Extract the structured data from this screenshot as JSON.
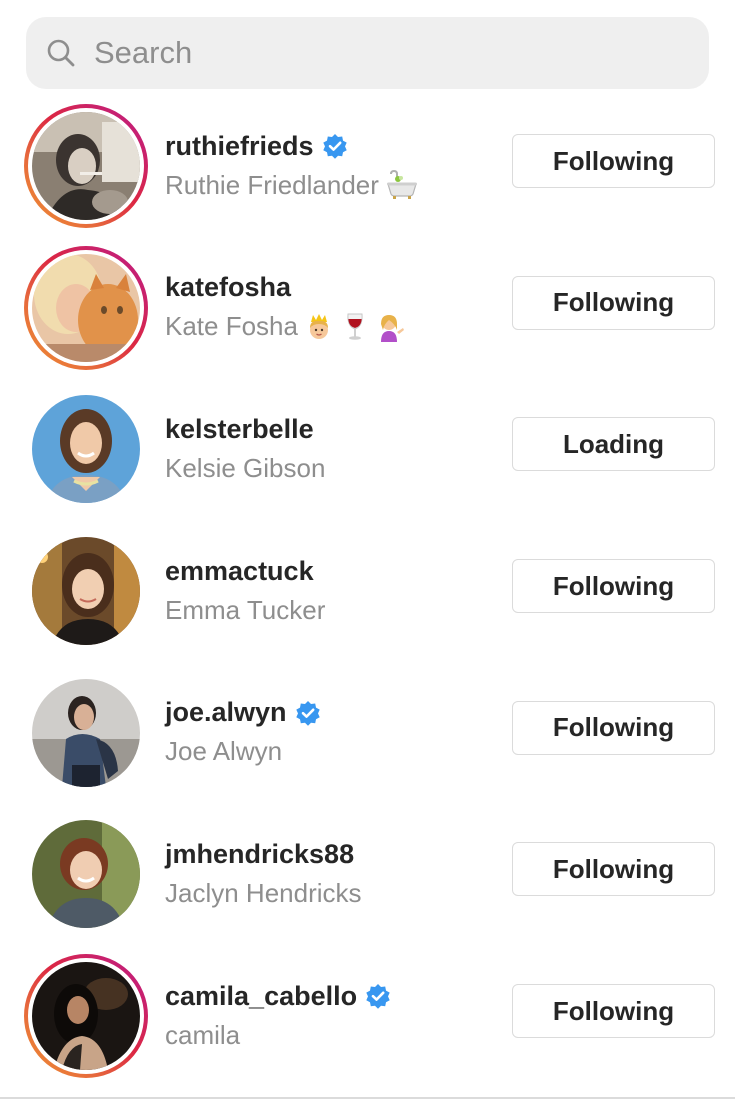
{
  "search": {
    "placeholder": "Search",
    "value": ""
  },
  "users": [
    {
      "username": "ruthiefrieds",
      "full_name": "Ruthie Friedlander",
      "verified": true,
      "has_story": true,
      "emojis": [
        "bathtub"
      ],
      "button": "Following"
    },
    {
      "username": "katefosha",
      "full_name": "Kate Fosha",
      "verified": false,
      "has_story": true,
      "emojis": [
        "princess",
        "wine-glass",
        "tipping-hand-woman"
      ],
      "button": "Following"
    },
    {
      "username": "kelsterbelle",
      "full_name": "Kelsie Gibson",
      "verified": false,
      "has_story": false,
      "emojis": [],
      "button": "Loading"
    },
    {
      "username": "emmactuck",
      "full_name": "Emma Tucker",
      "verified": false,
      "has_story": false,
      "emojis": [],
      "button": "Following"
    },
    {
      "username": "joe.alwyn",
      "full_name": "Joe Alwyn",
      "verified": true,
      "has_story": false,
      "emojis": [],
      "button": "Following"
    },
    {
      "username": "jmhendricks88",
      "full_name": "Jaclyn Hendricks",
      "verified": false,
      "has_story": false,
      "emojis": [],
      "button": "Following"
    },
    {
      "username": "camila_cabello",
      "full_name": "camila",
      "verified": true,
      "has_story": true,
      "emojis": [],
      "button": "Following"
    }
  ],
  "colors": {
    "verified_blue": "#3897f0",
    "secondary_text": "#8e8e8e",
    "primary_text": "#262626",
    "search_bg": "#efefef",
    "button_border": "#dbdbdb"
  }
}
